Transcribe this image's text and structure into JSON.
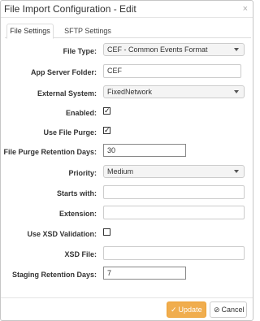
{
  "dialog": {
    "title": "File Import Configuration - Edit",
    "close_glyph": "×"
  },
  "tabs": [
    {
      "label": "File Settings",
      "active": true
    },
    {
      "label": "SFTP Settings",
      "active": false
    }
  ],
  "fields": {
    "file_type": {
      "label": "File Type:",
      "value": "CEF - Common Events Format"
    },
    "app_server_folder": {
      "label": "App Server Folder:",
      "value": "CEF"
    },
    "external_system": {
      "label": "External System:",
      "value": "FixedNetwork"
    },
    "enabled": {
      "label": "Enabled:",
      "checked": true
    },
    "use_file_purge": {
      "label": "Use File Purge:",
      "checked": true
    },
    "file_purge_retention_days": {
      "label": "File Purge Retention Days:",
      "value": "30"
    },
    "priority": {
      "label": "Priority:",
      "value": "Medium"
    },
    "starts_with": {
      "label": "Starts with:",
      "value": ""
    },
    "extension": {
      "label": "Extension:",
      "value": ""
    },
    "use_xsd_validation": {
      "label": "Use XSD Validation:",
      "checked": false
    },
    "xsd_file": {
      "label": "XSD File:",
      "value": ""
    },
    "staging_retention_days": {
      "label": "Staging Retention Days:",
      "value": "7"
    }
  },
  "footer": {
    "update_label": "Update",
    "cancel_label": "Cancel"
  },
  "colors": {
    "update_bg": "#f0ad4e",
    "update_border": "#eea236"
  }
}
